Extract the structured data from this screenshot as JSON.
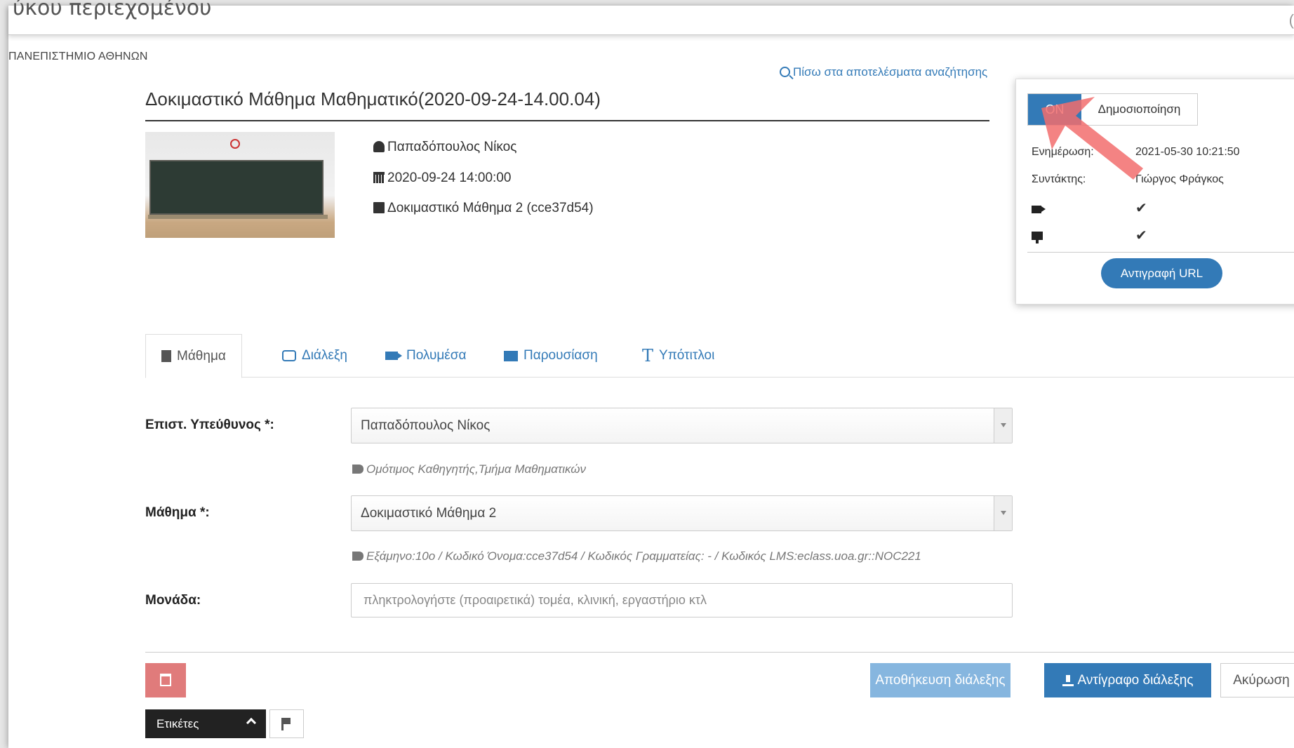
{
  "window": {
    "title": "ύκου περιεχομένου",
    "close_glyph": "("
  },
  "organization": "ΠΑΝΕΠΙΣΤΗΜΙΟ ΑΘΗΝΩΝ",
  "back_link": "Πίσω στα αποτελέσματα αναζήτησης",
  "lecture": {
    "title": "Δοκιμαστικό Μάθημα Μαθηματικό(2020-09-24-14.00.04)",
    "author": "Παπαδόπουλος Νίκος",
    "datetime": "2020-09-24  14:00:00",
    "course": "Δοκιμαστικό Μάθημα 2 (cce37d54)"
  },
  "publish_panel": {
    "toggle_on": "ON",
    "toggle_label": "Δημοσιοποίηση",
    "updated_label": "Ενημέρωση:",
    "updated_value": "2021-05-30 10:21:50",
    "editor_label": "Συντάκτης:",
    "editor_value": "Γιώργος Φράγκος",
    "check": "✔",
    "copy_url": "Αντιγραφή URL"
  },
  "tabs": [
    {
      "label": "Μάθημα",
      "icon": "lesson-icon",
      "active": true
    },
    {
      "label": "Διάλεξη",
      "icon": "speech-bubble-icon"
    },
    {
      "label": "Πολυμέσα",
      "icon": "video-camera-icon"
    },
    {
      "label": "Παρουσίαση",
      "icon": "presentation-icon"
    },
    {
      "label": "Υπότιτλοι",
      "icon": "text-icon",
      "glyph": "T"
    }
  ],
  "form": {
    "supervisor_label": "Επιστ. Υπεύθυνος *:",
    "supervisor_value": "Παπαδόπουλος Νίκος",
    "supervisor_hint": "Ομότιμος Καθηγητής,Τμήμα Μαθηματικών",
    "course_label": "Μάθημα *:",
    "course_value": "Δοκιμαστικό Μάθημα 2",
    "course_hint": "Εξάμηνο:10ο / Κωδικό Όνομα:cce37d54 / Κωδικός Γραμματείας: - / Κωδικός LMS:eclass.uoa.gr::NOC221",
    "unit_label": "Μονάδα:",
    "unit_placeholder": "πληκτρολογήστε (προαιρετικά) τομέα, κλινική, εργαστήριο κτλ"
  },
  "footer": {
    "tags": "Ετικέτες",
    "save": "Αποθήκευση διάλεξης",
    "duplicate": "Αντίγραφο διάλεξης",
    "cancel": "Ακύρωση"
  },
  "colors": {
    "primary": "#337ab7",
    "danger": "#e07b7b",
    "annotation_arrow": "#f26d6d"
  }
}
